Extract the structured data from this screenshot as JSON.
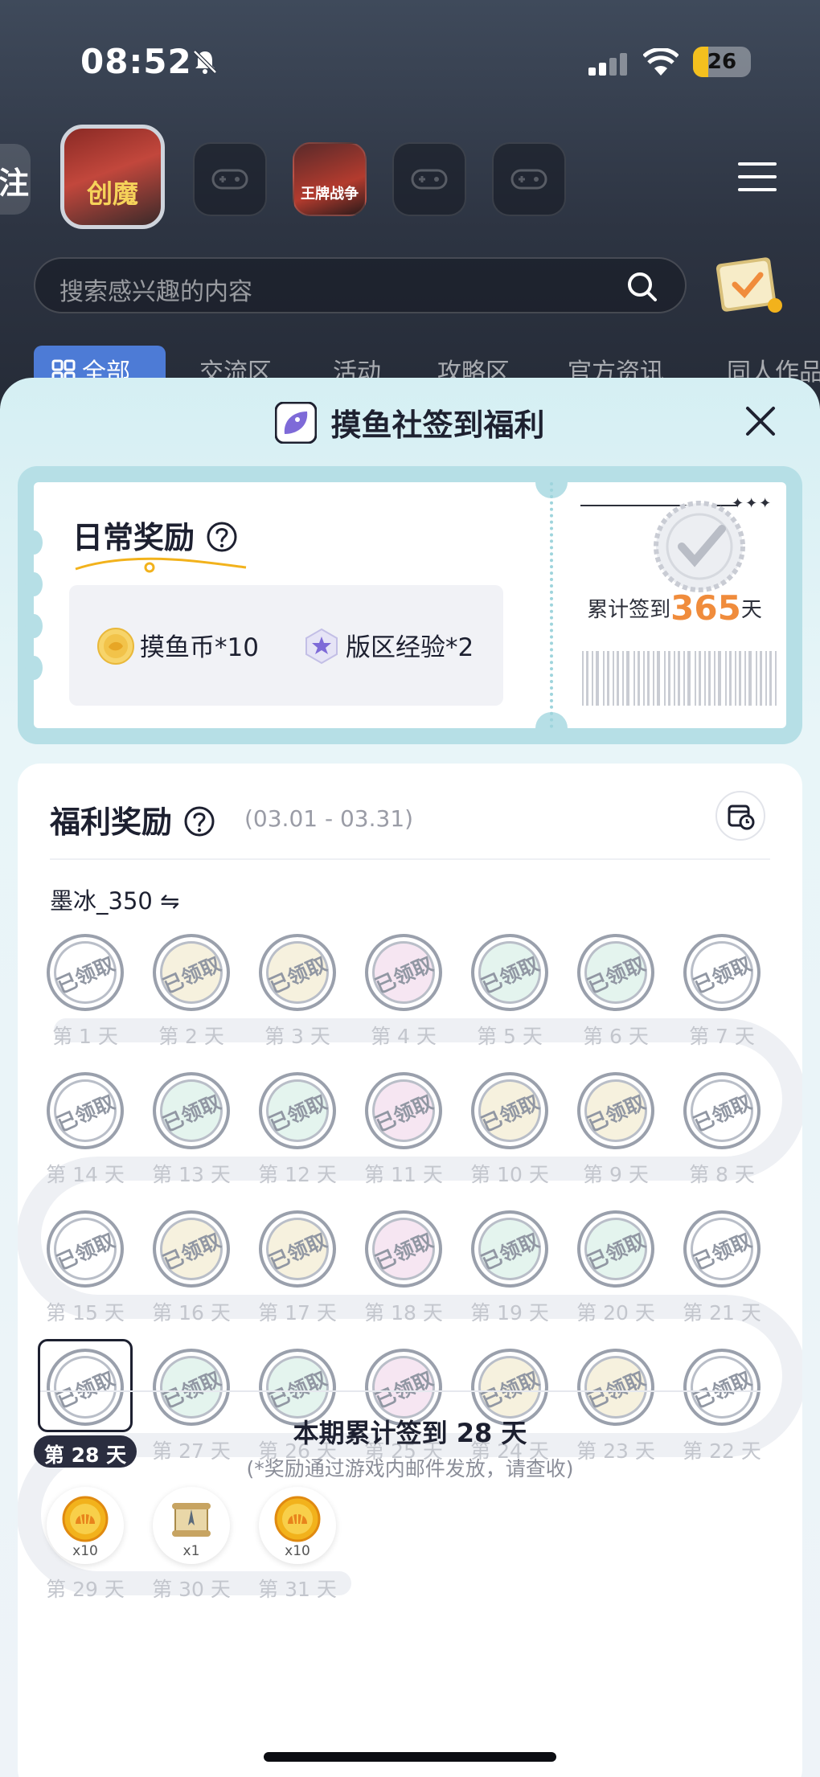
{
  "status_bar": {
    "time": "08:52",
    "battery": "26",
    "battery_level": 0.26
  },
  "games": {
    "partial_tab_label": "注",
    "active_game_label": "创魔",
    "second_game_label": "王牌战争"
  },
  "search": {
    "placeholder": "搜索感兴趣的内容"
  },
  "tabs": [
    {
      "label": "全部"
    },
    {
      "label": "交流区"
    },
    {
      "label": "活动"
    },
    {
      "label": "攻略区"
    },
    {
      "label": "官方资讯"
    },
    {
      "label": "同人作品"
    }
  ],
  "sheet": {
    "title": "摸鱼社签到福利",
    "daily": {
      "title": "日常奖励",
      "rewards": [
        {
          "icon": "fish-coin-icon",
          "label": "摸鱼币*10"
        },
        {
          "icon": "forum-exp-icon",
          "label": "版区经验*2"
        }
      ],
      "streak_prefix": "累计签到",
      "streak_days": "365",
      "streak_suffix": "天"
    },
    "welfare": {
      "title": "福利奖励",
      "range": "(03.01 - 03.31)",
      "account": "墨冰_350 ⇋",
      "claimed_stamp": "已领取",
      "days": [
        {
          "label": "第 1 天",
          "state": "claimed"
        },
        {
          "label": "第 2 天",
          "state": "claimed"
        },
        {
          "label": "第 3 天",
          "state": "claimed"
        },
        {
          "label": "第 4 天",
          "state": "claimed"
        },
        {
          "label": "第 5 天",
          "state": "claimed"
        },
        {
          "label": "第 6 天",
          "state": "claimed"
        },
        {
          "label": "第 7 天",
          "state": "claimed"
        },
        {
          "label": "第 8 天",
          "state": "claimed"
        },
        {
          "label": "第 9 天",
          "state": "claimed"
        },
        {
          "label": "第 10 天",
          "state": "claimed"
        },
        {
          "label": "第 11 天",
          "state": "claimed"
        },
        {
          "label": "第 12 天",
          "state": "claimed"
        },
        {
          "label": "第 13 天",
          "state": "claimed"
        },
        {
          "label": "第 14 天",
          "state": "claimed"
        },
        {
          "label": "第 15 天",
          "state": "claimed"
        },
        {
          "label": "第 16 天",
          "state": "claimed"
        },
        {
          "label": "第 17 天",
          "state": "claimed"
        },
        {
          "label": "第 18 天",
          "state": "claimed"
        },
        {
          "label": "第 19 天",
          "state": "claimed"
        },
        {
          "label": "第 20 天",
          "state": "claimed"
        },
        {
          "label": "第 21 天",
          "state": "claimed"
        },
        {
          "label": "第 22 天",
          "state": "claimed"
        },
        {
          "label": "第 23 天",
          "state": "claimed"
        },
        {
          "label": "第 24 天",
          "state": "claimed"
        },
        {
          "label": "第 25 天",
          "state": "claimed"
        },
        {
          "label": "第 26 天",
          "state": "claimed"
        },
        {
          "label": "第 27 天",
          "state": "claimed"
        },
        {
          "label": "第 28 天",
          "state": "current"
        },
        {
          "label": "第 29 天",
          "state": "future",
          "reward_icon": "gold-shell-coin-icon",
          "qty": "x10"
        },
        {
          "label": "第 30 天",
          "state": "future",
          "reward_icon": "scroll-trophy-icon",
          "qty": "x1"
        },
        {
          "label": "第 31 天",
          "state": "future",
          "reward_icon": "gold-shell-coin-icon",
          "qty": "x10"
        }
      ],
      "total": "本期累计签到 28 天",
      "note": "(*奖励通过游戏内邮件发放，请查收)"
    }
  },
  "colors": {
    "accent_orange": "#f08c3c",
    "tab_blue": "#4d7bd6",
    "ticket_teal": "#b6dfe6",
    "coin_gold": "#f2b21c"
  }
}
